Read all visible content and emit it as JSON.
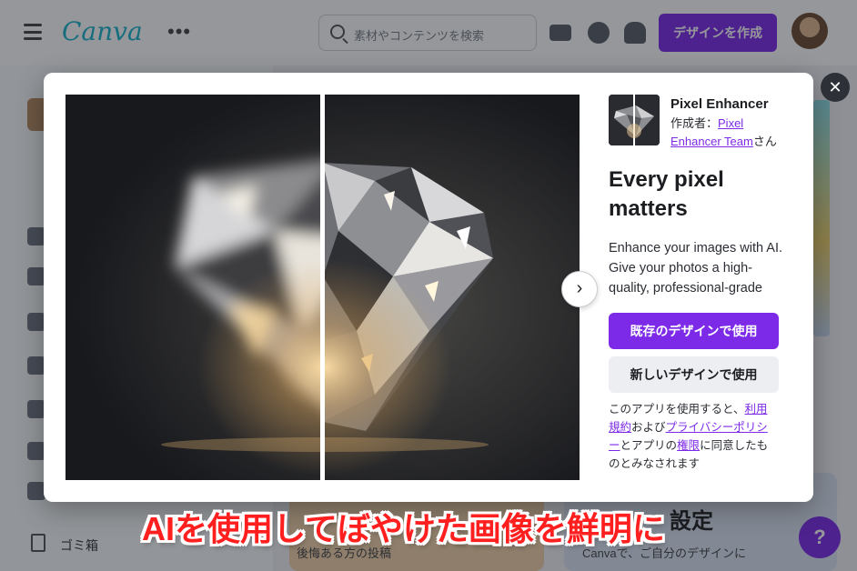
{
  "background_app": {
    "logo": "Canva",
    "search_placeholder": "素材やコンテンツを検索",
    "create_button": "デザインを作成",
    "sidebar_trash": "ゴミ箱",
    "card_title": "設定",
    "card_text_left": "後悔ある方の投稿",
    "card_text_right": "Canvaで、ご自分のデザインに",
    "help_glyph": "?"
  },
  "modal": {
    "close_glyph": "✕",
    "next_glyph": "›",
    "app_name": "Pixel Enhancer",
    "author_prefix": "作成者：",
    "author_link": "Pixel Enhancer Team",
    "author_suffix": "さん",
    "headline": "Every pixel matters",
    "description": "Enhance your images with AI. Give your photos a high-quality, professional-grade",
    "primary_button": "既存のデザインで使用",
    "secondary_button": "新しいデザインで使用",
    "terms": {
      "t1": "このアプリを使用すると、",
      "link_terms": "利用規約",
      "t2": "および",
      "link_privacy": "プライバシーポリシー",
      "t3": "と",
      "t4": "アプリの",
      "link_permissions": "権限",
      "t5": "に同意したものとみなされます"
    }
  },
  "caption": "AIを使用してぼやけた画像を鮮明に",
  "colors": {
    "brand_purple": "#7d2ae8",
    "caption_red": "#ff1f1f",
    "logo_teal": "#17b3c8"
  }
}
